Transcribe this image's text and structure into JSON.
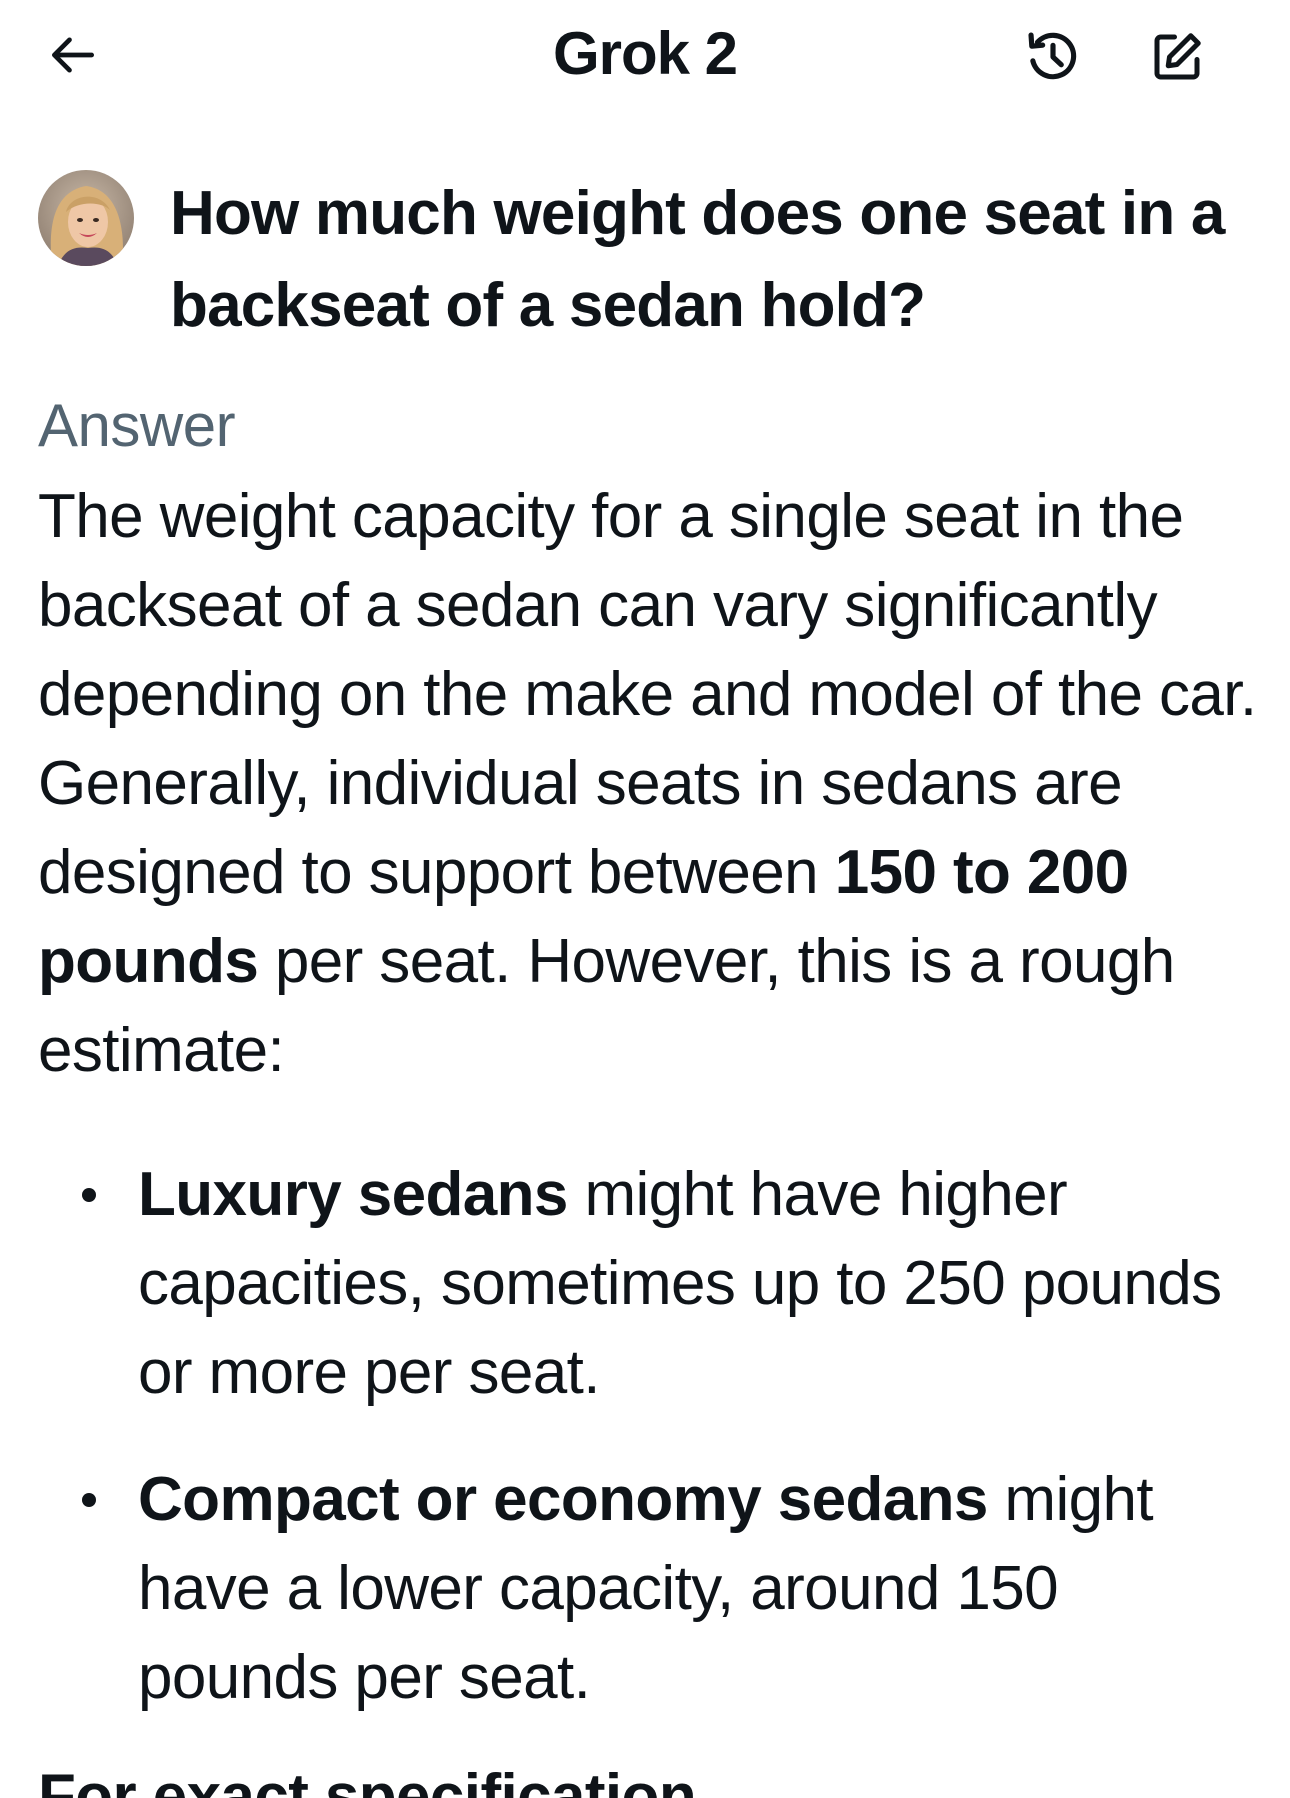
{
  "header": {
    "title": "Grok 2",
    "back_icon": "arrow-left-icon",
    "history_icon": "history-icon",
    "compose_icon": "compose-icon"
  },
  "question": {
    "text": "How much weight does one seat in a backseat of a sedan hold?"
  },
  "answer": {
    "label": "Answer",
    "intro_1": "The weight capacity for a single seat in the backseat of a sedan can vary significantly depending on the make and model of the car. Generally, individual seats in sedans are designed to support between ",
    "intro_bold": "150 to 200 pounds",
    "intro_2": " per seat. However, this is a rough estimate:",
    "bullets": [
      {
        "bold": "Luxury sedans",
        "text": " might have higher capacities, sometimes up to 250 pounds or more per seat."
      },
      {
        "bold": "Compact or economy sedans",
        "text": " might have a lower capacity, around 150 pounds per seat."
      }
    ],
    "next_heading_partial": "For exact specification"
  },
  "colors": {
    "text": "#0f1419",
    "secondary": "#536471",
    "background": "#ffffff"
  }
}
